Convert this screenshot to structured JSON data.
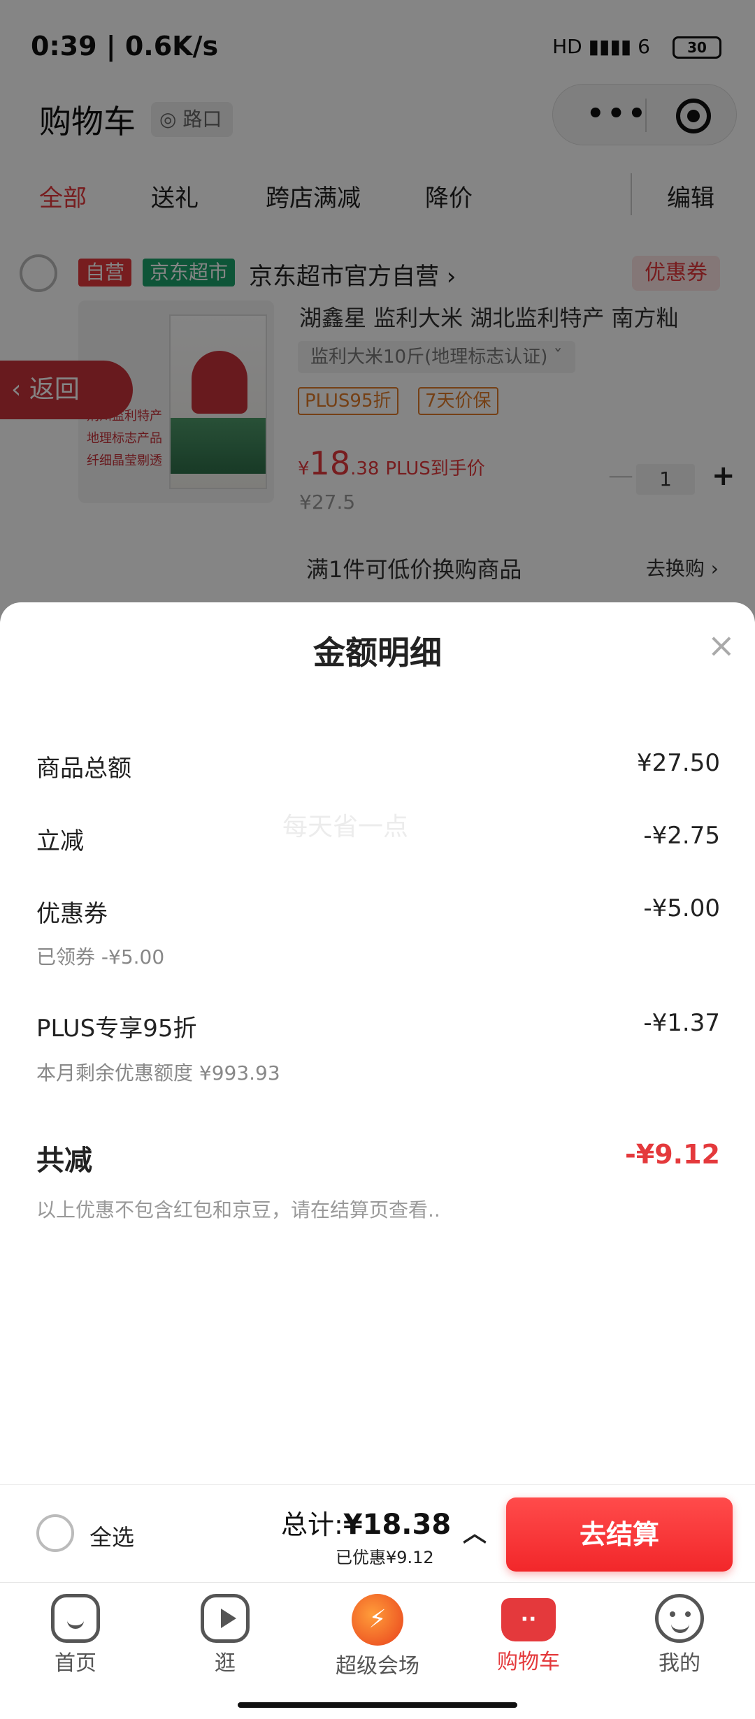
{
  "status_bar": {
    "time": "0:39 | 0.6K/s",
    "signal": "HD ▮▮▮▮ 6",
    "battery": "30"
  },
  "header": {
    "title": "购物车",
    "location": "路口"
  },
  "tabs": [
    {
      "label": "全部",
      "active": true
    },
    {
      "label": "送礼"
    },
    {
      "label": "跨店满减"
    },
    {
      "label": "降价"
    },
    {
      "label": "编辑"
    }
  ],
  "shop": {
    "tag_self": "自营",
    "tag_supermarket": "京东超市",
    "name": "京东超市官方自营 ›",
    "coupon": "优惠券"
  },
  "product": {
    "name": "湖鑫星 监利大米 湖北监利特产 南方籼",
    "spec": "监利大米10斤(地理标志认证) ˇ",
    "tags": [
      "PLUS95折",
      "7天价保"
    ],
    "image_text": [
      "荆州监利特产",
      "地理标志产品",
      "纤细晶莹剔透"
    ],
    "price_symbol": "¥",
    "price_int": "18",
    "price_dec": ".38",
    "price_note": "PLUS到手价",
    "original_price": "¥27.5",
    "quantity": "1",
    "swap_text": "满1件可低价换购商品",
    "swap_link": "去换购 ›"
  },
  "back_button": "返回",
  "sheet": {
    "title": "金额明细",
    "watermark": "每天省一点",
    "rows": [
      {
        "label": "商品总额",
        "value": "¥27.50"
      },
      {
        "label": "立减",
        "value": "-¥2.75"
      },
      {
        "label": "优惠券",
        "value": "-¥5.00",
        "sub": "已领券 -¥5.00"
      },
      {
        "label": "PLUS专享95折",
        "value": "-¥1.37",
        "sub": "本月剩余优惠额度 ¥993.93"
      }
    ],
    "total_label": "共减",
    "total_value": "-¥9.12",
    "note": "以上优惠不包含红包和京豆，请在结算页查看.."
  },
  "checkout": {
    "select_all": "全选",
    "total_label": "总计:",
    "total_value": "¥18.38",
    "saved": "已优惠¥9.12",
    "pay_button": "去结算"
  },
  "tabbar": [
    {
      "label": "首页",
      "icon": "home-icon"
    },
    {
      "label": "逛",
      "icon": "play-icon"
    },
    {
      "label": "超级会场",
      "icon": "super-venue-icon"
    },
    {
      "label": "购物车",
      "icon": "cart-icon",
      "active": true
    },
    {
      "label": "我的",
      "icon": "smile-icon"
    }
  ],
  "colors": {
    "accent": "#e4393c",
    "supermarket_green": "#1ca36b",
    "plus_orange": "#e07b2a"
  }
}
